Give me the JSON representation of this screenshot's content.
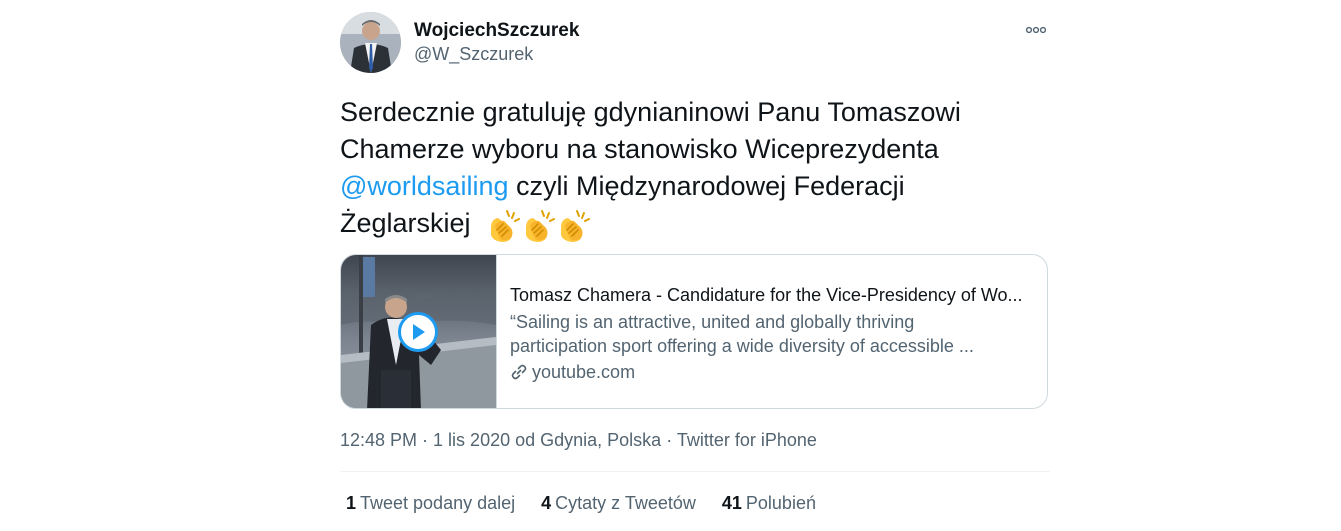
{
  "author": {
    "display_name": "WojciechSzczurek",
    "handle": "@W_Szczurek"
  },
  "tweet": {
    "text_part1": "Serdecznie gratuluję gdynianinowi Panu Tomaszowi Chamerze wyboru na stanowisko Wiceprezydenta ",
    "mention": "@worldsailing",
    "text_part2": " czyli Międzynarodowej Federacji Żeglarskiej",
    "emoji": [
      "clapping-hands",
      "clapping-hands",
      "clapping-hands"
    ]
  },
  "card": {
    "title": "Tomasz Chamera - Candidature for the Vice-Presidency of Wo...",
    "description": "“Sailing is an attractive, united and globally thriving participation sport offering a wide diversity of accessible ...",
    "domain": "youtube.com"
  },
  "meta": {
    "time": "12:48 PM",
    "sep1": " · ",
    "date_place": "1 lis 2020 od Gdynia, Polska",
    "sep2": " · ",
    "client": "Twitter for iPhone"
  },
  "stats": {
    "retweets_count": "1",
    "retweets_label": "Tweet podany dalej",
    "quotes_count": "4",
    "quotes_label": "Cytaty z Tweetów",
    "likes_count": "41",
    "likes_label": "Polubień"
  },
  "colors": {
    "link": "#1d9bf0",
    "secondary_text": "#536471",
    "border": "#cfd9de"
  }
}
